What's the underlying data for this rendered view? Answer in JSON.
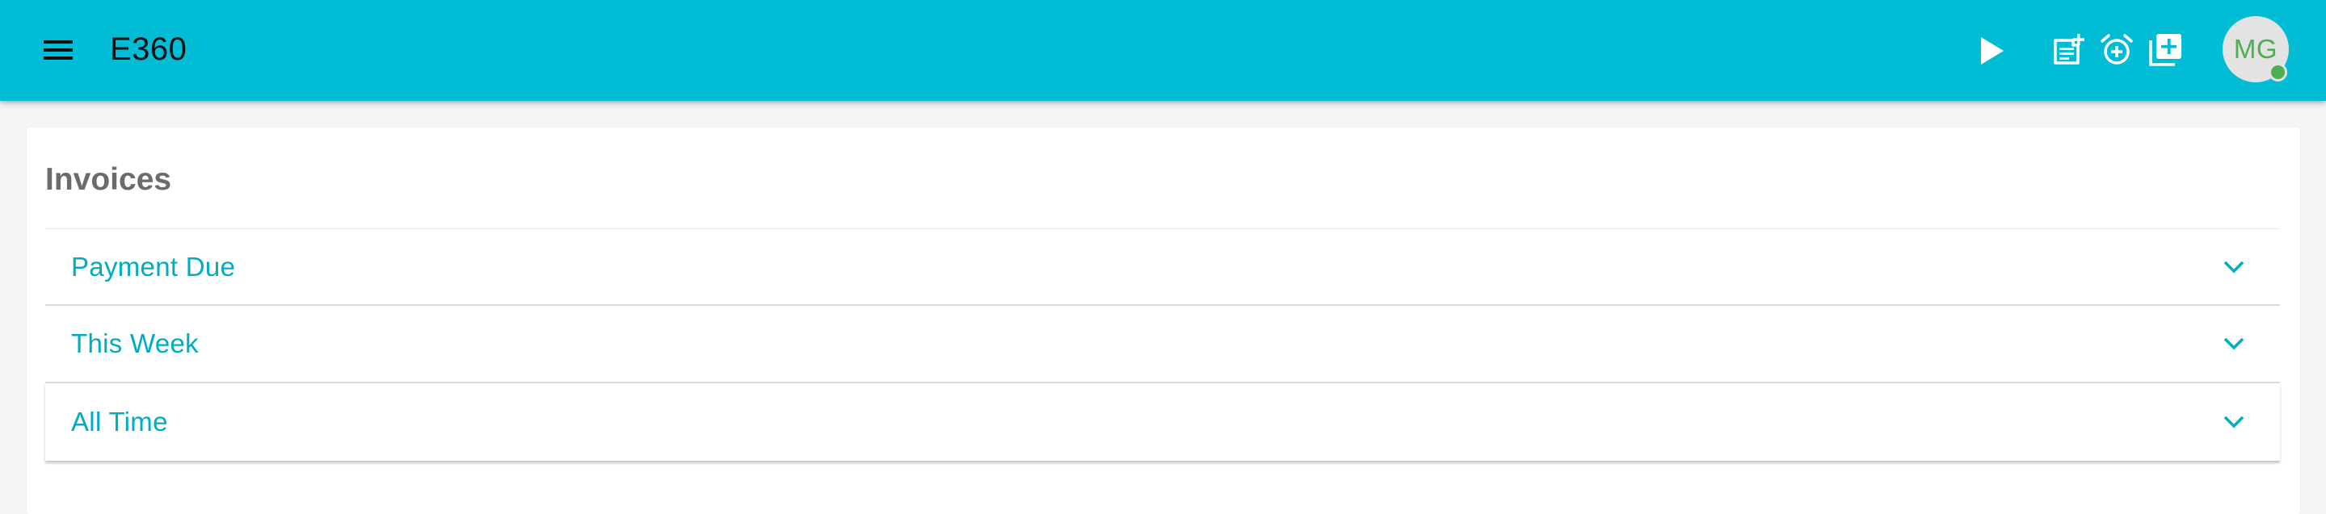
{
  "app": {
    "title": "E360",
    "avatar_initials": "MG"
  },
  "toolbar": {
    "icons": [
      "menu-icon",
      "play-icon",
      "note-add-icon",
      "alarm-add-icon",
      "library-add-icon"
    ]
  },
  "page": {
    "title": "Invoices",
    "panels": [
      {
        "label": "Payment Due"
      },
      {
        "label": "This Week"
      },
      {
        "label": "All Time"
      }
    ]
  },
  "colors": {
    "primary": "#00bcd4",
    "accent_text": "#00acc1",
    "avatar_text": "#4caf50",
    "status_online": "#4caf50"
  }
}
